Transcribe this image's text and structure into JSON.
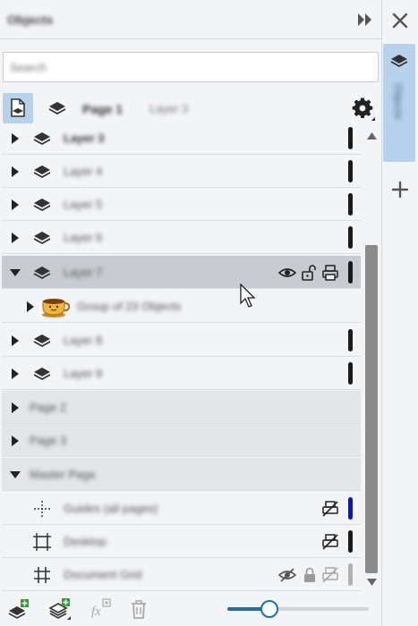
{
  "header": {
    "title": "Objects"
  },
  "rail": {
    "tab_label": "Objects"
  },
  "search": {
    "placeholder": "Search"
  },
  "toolbar": {
    "page_label": "Page 1",
    "layer_label": "Layer 3"
  },
  "rows": [
    {
      "label": "Layer 3",
      "color": "#1a1a1a"
    },
    {
      "label": "Layer 4",
      "color": "#1a1a1a"
    },
    {
      "label": "Layer 5",
      "color": "#1a1a1a"
    },
    {
      "label": "Layer 6",
      "color": "#1a1a1a"
    },
    {
      "label": "Layer 7",
      "color": "#1a1a1a",
      "selected": true
    },
    {
      "label": "Group of 23 Objects"
    },
    {
      "label": "Layer 8",
      "color": "#1a1a1a"
    },
    {
      "label": "Layer 9",
      "color": "#1a1a1a"
    },
    {
      "label": "Page 2"
    },
    {
      "label": "Page 3"
    },
    {
      "label": "Master Page"
    },
    {
      "label": "Guides (all pages)",
      "color": "#0a10e0"
    },
    {
      "label": "Desktop",
      "color": "#1a1a1a"
    },
    {
      "label": "Document Grid",
      "color": "#b0b0b0"
    }
  ],
  "colors": {
    "accent": "#1d6fb3",
    "selection": "#c8cbcf",
    "tab_active": "#b7d2ea"
  },
  "zoom_slider": {
    "value": 0.3
  }
}
